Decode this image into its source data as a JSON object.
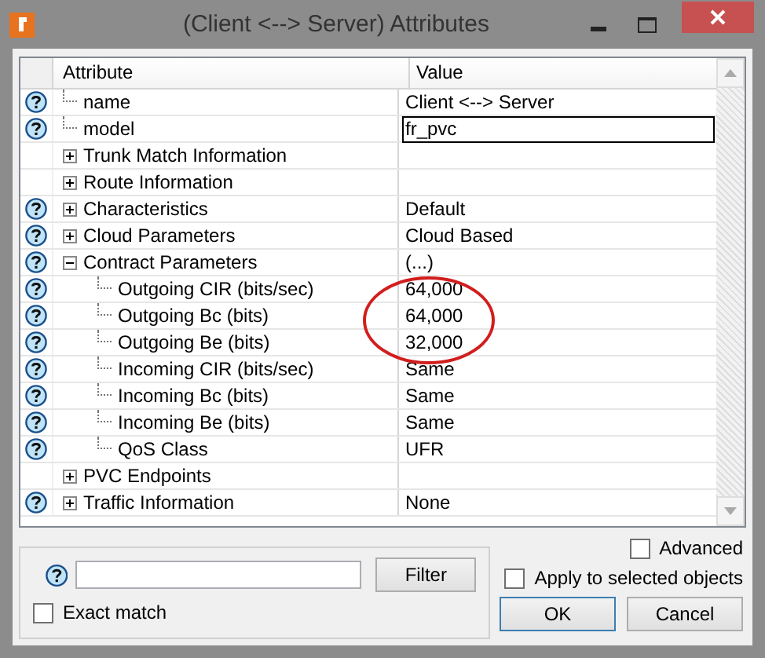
{
  "window": {
    "title": "(Client <--> Server) Attributes"
  },
  "table": {
    "columns": [
      "Attribute",
      "Value"
    ],
    "rows": [
      {
        "label": "name",
        "value": "Client <--> Server",
        "help": true,
        "kind": "leaf"
      },
      {
        "label": "model",
        "value": "fr_pvc",
        "help": true,
        "kind": "edit"
      },
      {
        "label": "Trunk Match Information",
        "value": "",
        "help": false,
        "kind": "group",
        "expanded": false
      },
      {
        "label": "Route Information",
        "value": "",
        "help": false,
        "kind": "group",
        "expanded": false
      },
      {
        "label": "Characteristics",
        "value": "Default",
        "help": true,
        "kind": "group",
        "expanded": false
      },
      {
        "label": "Cloud Parameters",
        "value": "Cloud Based",
        "help": true,
        "kind": "group",
        "expanded": false
      },
      {
        "label": "Contract Parameters",
        "value": "(...)",
        "help": true,
        "kind": "group",
        "expanded": true,
        "children": [
          {
            "label": "Outgoing CIR (bits/sec)",
            "value": "64,000",
            "help": true,
            "kind": "leaf"
          },
          {
            "label": "Outgoing Bc (bits)",
            "value": "64,000",
            "help": true,
            "kind": "leaf"
          },
          {
            "label": "Outgoing Be (bits)",
            "value": "32,000",
            "help": true,
            "kind": "leaf"
          },
          {
            "label": "Incoming CIR (bits/sec)",
            "value": "Same",
            "help": true,
            "kind": "leaf"
          },
          {
            "label": "Incoming Bc (bits)",
            "value": "Same",
            "help": true,
            "kind": "leaf"
          },
          {
            "label": "Incoming Be (bits)",
            "value": "Same",
            "help": true,
            "kind": "leaf"
          },
          {
            "label": "QoS Class",
            "value": "UFR",
            "help": true,
            "kind": "leaf"
          }
        ]
      },
      {
        "label": "PVC Endpoints",
        "value": "",
        "help": false,
        "kind": "group",
        "expanded": false
      },
      {
        "label": "Traffic Information",
        "value": "None",
        "help": true,
        "kind": "group",
        "expanded": false
      }
    ]
  },
  "filter": {
    "button": "Filter",
    "exact_match": {
      "label": "Exact match",
      "checked": false
    }
  },
  "advanced": {
    "label": "Advanced",
    "checked": false
  },
  "apply_selected": {
    "label": "Apply to selected objects",
    "checked": false
  },
  "buttons": [
    "OK",
    "Cancel"
  ]
}
